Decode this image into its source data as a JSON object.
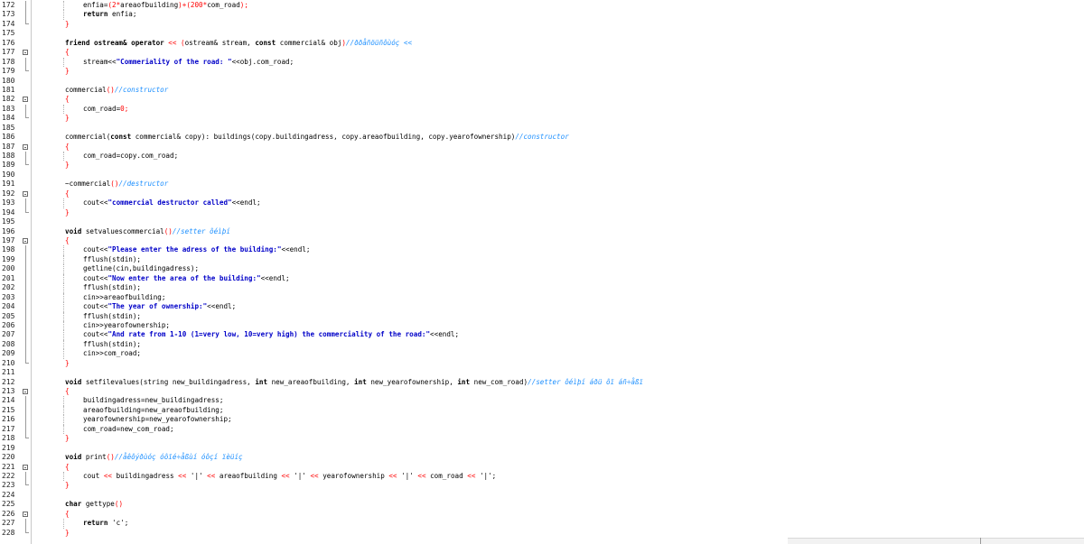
{
  "editor": {
    "lines": [
      {
        "n": "172",
        "fold": "line",
        "indent": 1,
        "segs": [
          {
            "t": "enfia=",
            "c": ""
          },
          {
            "t": "(2*",
            "c": "red"
          },
          {
            "t": "areaofbuilding",
            "c": ""
          },
          {
            "t": ")+(200*",
            "c": "red"
          },
          {
            "t": "com_road",
            "c": ""
          },
          {
            "t": ");",
            "c": "red"
          }
        ]
      },
      {
        "n": "173",
        "fold": "line",
        "indent": 1,
        "segs": [
          {
            "t": "return ",
            "c": "kw"
          },
          {
            "t": "enfia;",
            "c": ""
          }
        ]
      },
      {
        "n": "174",
        "fold": "end",
        "indent": 0,
        "segs": [
          {
            "t": "}",
            "c": "red"
          }
        ]
      },
      {
        "n": "175",
        "fold": "",
        "indent": 0,
        "segs": []
      },
      {
        "n": "176",
        "fold": "",
        "indent": 0,
        "segs": [
          {
            "t": "friend ostream& operator ",
            "c": "kw"
          },
          {
            "t": "<< (",
            "c": "red"
          },
          {
            "t": "ostream& stream, ",
            "c": ""
          },
          {
            "t": "const ",
            "c": "kw"
          },
          {
            "t": "commercial& obj",
            "c": ""
          },
          {
            "t": ")",
            "c": "red"
          },
          {
            "t": "//ððåñöüñôùóç <<",
            "c": "cmt"
          }
        ]
      },
      {
        "n": "177",
        "fold": "box",
        "indent": 0,
        "segs": [
          {
            "t": "{",
            "c": "red"
          }
        ]
      },
      {
        "n": "178",
        "fold": "line",
        "indent": 1,
        "segs": [
          {
            "t": "stream<<",
            "c": ""
          },
          {
            "t": "\"Commeriality of the road: \"",
            "c": "str"
          },
          {
            "t": "<<obj.com_road;",
            "c": ""
          }
        ]
      },
      {
        "n": "179",
        "fold": "end",
        "indent": 0,
        "segs": [
          {
            "t": "}",
            "c": "red"
          }
        ]
      },
      {
        "n": "180",
        "fold": "",
        "indent": 0,
        "segs": []
      },
      {
        "n": "181",
        "fold": "",
        "indent": 0,
        "segs": [
          {
            "t": "commercial",
            "c": ""
          },
          {
            "t": "()",
            "c": "red"
          },
          {
            "t": "//constructor",
            "c": "cmt"
          }
        ]
      },
      {
        "n": "182",
        "fold": "box",
        "indent": 0,
        "segs": [
          {
            "t": "{",
            "c": "red"
          }
        ]
      },
      {
        "n": "183",
        "fold": "line",
        "indent": 1,
        "segs": [
          {
            "t": "com_road=",
            "c": ""
          },
          {
            "t": "0;",
            "c": "red"
          }
        ]
      },
      {
        "n": "184",
        "fold": "end",
        "indent": 0,
        "segs": [
          {
            "t": "}",
            "c": "red"
          }
        ]
      },
      {
        "n": "185",
        "fold": "",
        "indent": 0,
        "segs": []
      },
      {
        "n": "186",
        "fold": "",
        "indent": 0,
        "segs": [
          {
            "t": "commercial(",
            "c": ""
          },
          {
            "t": "const ",
            "c": "kw"
          },
          {
            "t": "commercial& copy): buildings(copy.buildingadress, copy.areaofbuilding, copy.yearofownership)",
            "c": ""
          },
          {
            "t": "//constructor",
            "c": "cmt"
          }
        ]
      },
      {
        "n": "187",
        "fold": "box",
        "indent": 0,
        "segs": [
          {
            "t": "{",
            "c": "red"
          }
        ]
      },
      {
        "n": "188",
        "fold": "line",
        "indent": 1,
        "segs": [
          {
            "t": "com_road=copy.com_road;",
            "c": ""
          }
        ]
      },
      {
        "n": "189",
        "fold": "end",
        "indent": 0,
        "segs": [
          {
            "t": "}",
            "c": "red"
          }
        ]
      },
      {
        "n": "190",
        "fold": "",
        "indent": 0,
        "segs": []
      },
      {
        "n": "191",
        "fold": "",
        "indent": 0,
        "segs": [
          {
            "t": "~commercial",
            "c": ""
          },
          {
            "t": "()",
            "c": "red"
          },
          {
            "t": "//destructor",
            "c": "cmt"
          }
        ]
      },
      {
        "n": "192",
        "fold": "box",
        "indent": 0,
        "segs": [
          {
            "t": "{",
            "c": "red"
          }
        ]
      },
      {
        "n": "193",
        "fold": "line",
        "indent": 1,
        "segs": [
          {
            "t": "cout<<",
            "c": ""
          },
          {
            "t": "\"commercial destructor called\"",
            "c": "str"
          },
          {
            "t": "<<endl;",
            "c": ""
          }
        ]
      },
      {
        "n": "194",
        "fold": "end",
        "indent": 0,
        "segs": [
          {
            "t": "}",
            "c": "red"
          }
        ]
      },
      {
        "n": "195",
        "fold": "",
        "indent": 0,
        "segs": []
      },
      {
        "n": "196",
        "fold": "",
        "indent": 0,
        "segs": [
          {
            "t": "void ",
            "c": "kw"
          },
          {
            "t": "setvaluescommercial",
            "c": ""
          },
          {
            "t": "()",
            "c": "red"
          },
          {
            "t": "//setter ôéìþí",
            "c": "cmt"
          }
        ]
      },
      {
        "n": "197",
        "fold": "box",
        "indent": 0,
        "segs": [
          {
            "t": "{",
            "c": "red"
          }
        ]
      },
      {
        "n": "198",
        "fold": "line",
        "indent": 1,
        "segs": [
          {
            "t": "cout<<",
            "c": ""
          },
          {
            "t": "\"Please enter the adress of the building:\"",
            "c": "str"
          },
          {
            "t": "<<endl;",
            "c": ""
          }
        ]
      },
      {
        "n": "199",
        "fold": "line",
        "indent": 1,
        "segs": [
          {
            "t": "fflush(stdin);",
            "c": ""
          }
        ]
      },
      {
        "n": "200",
        "fold": "line",
        "indent": 1,
        "segs": [
          {
            "t": "getline(cin,buildingadress);",
            "c": ""
          }
        ]
      },
      {
        "n": "201",
        "fold": "line",
        "indent": 1,
        "segs": [
          {
            "t": "cout<<",
            "c": ""
          },
          {
            "t": "\"Now enter the area of the building:\"",
            "c": "str"
          },
          {
            "t": "<<endl;",
            "c": ""
          }
        ]
      },
      {
        "n": "202",
        "fold": "line",
        "indent": 1,
        "segs": [
          {
            "t": "fflush(stdin);",
            "c": ""
          }
        ]
      },
      {
        "n": "203",
        "fold": "line",
        "indent": 1,
        "segs": [
          {
            "t": "cin>>areaofbuilding;",
            "c": ""
          }
        ]
      },
      {
        "n": "204",
        "fold": "line",
        "indent": 1,
        "segs": [
          {
            "t": "cout<<",
            "c": ""
          },
          {
            "t": "\"The year of ownership:\"",
            "c": "str"
          },
          {
            "t": "<<endl;",
            "c": ""
          }
        ]
      },
      {
        "n": "205",
        "fold": "line",
        "indent": 1,
        "segs": [
          {
            "t": "fflush(stdin);",
            "c": ""
          }
        ]
      },
      {
        "n": "206",
        "fold": "line",
        "indent": 1,
        "segs": [
          {
            "t": "cin>>yearofownership;",
            "c": ""
          }
        ]
      },
      {
        "n": "207",
        "fold": "line",
        "indent": 1,
        "segs": [
          {
            "t": "cout<<",
            "c": ""
          },
          {
            "t": "\"And rate from 1-10 (1=very low, 10=very high) the commerciality of the road:\"",
            "c": "str"
          },
          {
            "t": "<<endl;",
            "c": ""
          }
        ]
      },
      {
        "n": "208",
        "fold": "line",
        "indent": 1,
        "segs": [
          {
            "t": "fflush(stdin);",
            "c": ""
          }
        ]
      },
      {
        "n": "209",
        "fold": "line",
        "indent": 1,
        "segs": [
          {
            "t": "cin>>com_road;",
            "c": ""
          }
        ]
      },
      {
        "n": "210",
        "fold": "end",
        "indent": 0,
        "segs": [
          {
            "t": "}",
            "c": "red"
          }
        ]
      },
      {
        "n": "211",
        "fold": "",
        "indent": 0,
        "segs": []
      },
      {
        "n": "212",
        "fold": "",
        "indent": 0,
        "segs": [
          {
            "t": "void ",
            "c": "kw"
          },
          {
            "t": "setfilevalues(string new_buildingadress, ",
            "c": ""
          },
          {
            "t": "int ",
            "c": "kw"
          },
          {
            "t": "new_areaofbuilding, ",
            "c": ""
          },
          {
            "t": "int ",
            "c": "kw"
          },
          {
            "t": "new_yearofownership, ",
            "c": ""
          },
          {
            "t": "int ",
            "c": "kw"
          },
          {
            "t": "new_com_road)",
            "c": ""
          },
          {
            "t": "//setter ôéìþí áðü ôï áñ÷åßï",
            "c": "cmt"
          }
        ]
      },
      {
        "n": "213",
        "fold": "box",
        "indent": 0,
        "segs": [
          {
            "t": "{",
            "c": "red"
          }
        ]
      },
      {
        "n": "214",
        "fold": "line",
        "indent": 1,
        "segs": [
          {
            "t": "buildingadress=new_buildingadress;",
            "c": ""
          }
        ]
      },
      {
        "n": "215",
        "fold": "line",
        "indent": 1,
        "segs": [
          {
            "t": "areaofbuilding=new_areaofbuilding;",
            "c": ""
          }
        ]
      },
      {
        "n": "216",
        "fold": "line",
        "indent": 1,
        "segs": [
          {
            "t": "yearofownership=new_yearofownership;",
            "c": ""
          }
        ]
      },
      {
        "n": "217",
        "fold": "line",
        "indent": 1,
        "segs": [
          {
            "t": "com_road=new_com_road;",
            "c": ""
          }
        ]
      },
      {
        "n": "218",
        "fold": "end",
        "indent": 0,
        "segs": [
          {
            "t": "}",
            "c": "red"
          }
        ]
      },
      {
        "n": "219",
        "fold": "",
        "indent": 0,
        "segs": []
      },
      {
        "n": "220",
        "fold": "",
        "indent": 0,
        "segs": [
          {
            "t": "void ",
            "c": "kw"
          },
          {
            "t": "print",
            "c": ""
          },
          {
            "t": "()",
            "c": "red"
          },
          {
            "t": "//åêôýðùóç óôïé÷åßùí óôçí ïèüíç",
            "c": "cmt"
          }
        ]
      },
      {
        "n": "221",
        "fold": "box",
        "indent": 0,
        "segs": [
          {
            "t": "{",
            "c": "red"
          }
        ]
      },
      {
        "n": "222",
        "fold": "line",
        "indent": 1,
        "segs": [
          {
            "t": "cout ",
            "c": ""
          },
          {
            "t": "<< ",
            "c": "red"
          },
          {
            "t": "buildingadress ",
            "c": ""
          },
          {
            "t": "<< ",
            "c": "red"
          },
          {
            "t": "'|' ",
            "c": ""
          },
          {
            "t": "<< ",
            "c": "red"
          },
          {
            "t": "areaofbuilding ",
            "c": ""
          },
          {
            "t": "<< ",
            "c": "red"
          },
          {
            "t": "'|' ",
            "c": ""
          },
          {
            "t": "<< ",
            "c": "red"
          },
          {
            "t": "yearofownership ",
            "c": ""
          },
          {
            "t": "<< ",
            "c": "red"
          },
          {
            "t": "'|' ",
            "c": ""
          },
          {
            "t": "<< ",
            "c": "red"
          },
          {
            "t": "com_road ",
            "c": ""
          },
          {
            "t": "<< ",
            "c": "red"
          },
          {
            "t": "'|';",
            "c": ""
          }
        ]
      },
      {
        "n": "223",
        "fold": "end",
        "indent": 0,
        "segs": [
          {
            "t": "}",
            "c": "red"
          }
        ]
      },
      {
        "n": "224",
        "fold": "",
        "indent": 0,
        "segs": []
      },
      {
        "n": "225",
        "fold": "",
        "indent": 0,
        "segs": [
          {
            "t": "char ",
            "c": "kw"
          },
          {
            "t": "gettype",
            "c": ""
          },
          {
            "t": "()",
            "c": "red"
          }
        ]
      },
      {
        "n": "226",
        "fold": "box",
        "indent": 0,
        "segs": [
          {
            "t": "{",
            "c": "red"
          }
        ]
      },
      {
        "n": "227",
        "fold": "line",
        "indent": 1,
        "segs": [
          {
            "t": "return ",
            "c": "kw"
          },
          {
            "t": "'c';",
            "c": ""
          }
        ]
      },
      {
        "n": "228",
        "fold": "end",
        "indent": 0,
        "segs": [
          {
            "t": "}",
            "c": "red"
          }
        ]
      }
    ],
    "colors": {
      "keyword": "#000000",
      "string": "#0000c8",
      "comment": "#1e90ff",
      "operator": "#ff0000"
    }
  }
}
